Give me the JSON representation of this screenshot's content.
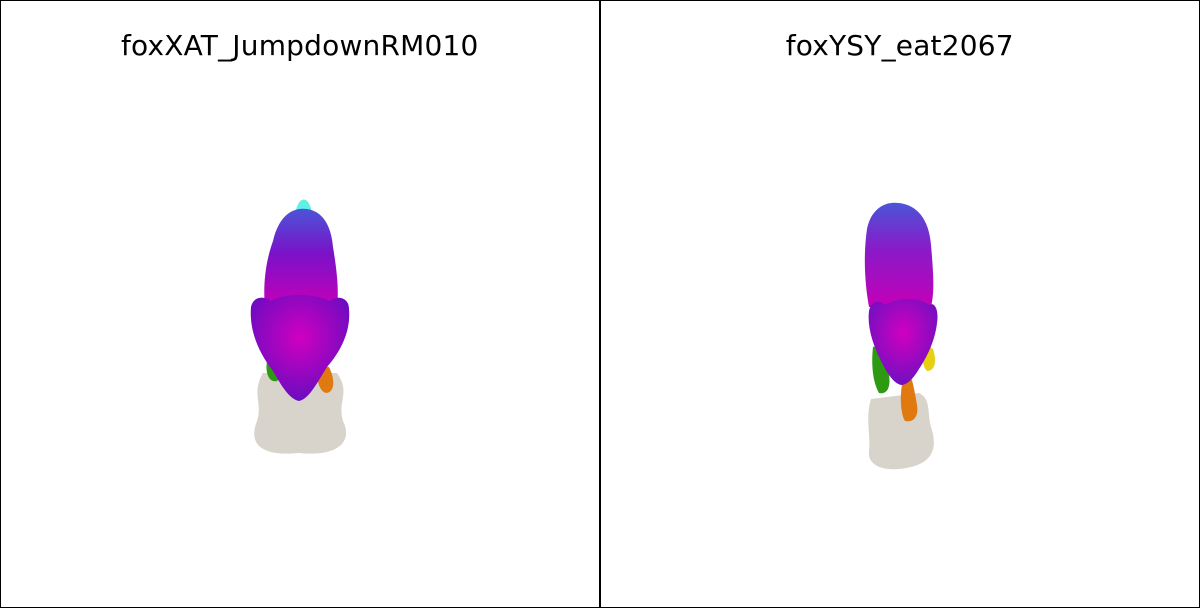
{
  "panels": [
    {
      "title": "foxXAT_JumpdownRM010",
      "figure": "fox-mesh-front-view"
    },
    {
      "title": "foxYSY_eat2067",
      "figure": "fox-mesh-front-view"
    }
  ],
  "colors": {
    "border": "#000000",
    "background": "#ffffff",
    "shadow": "#d8d4cc",
    "body_magenta": "#c400b8",
    "body_blue": "#4b55d8",
    "body_purple": "#7a12c8",
    "tail_cyan": "#5ff0e6",
    "leg_green": "#2e9a14",
    "leg_orange": "#e07a10",
    "leg_yellow": "#e6d010"
  }
}
